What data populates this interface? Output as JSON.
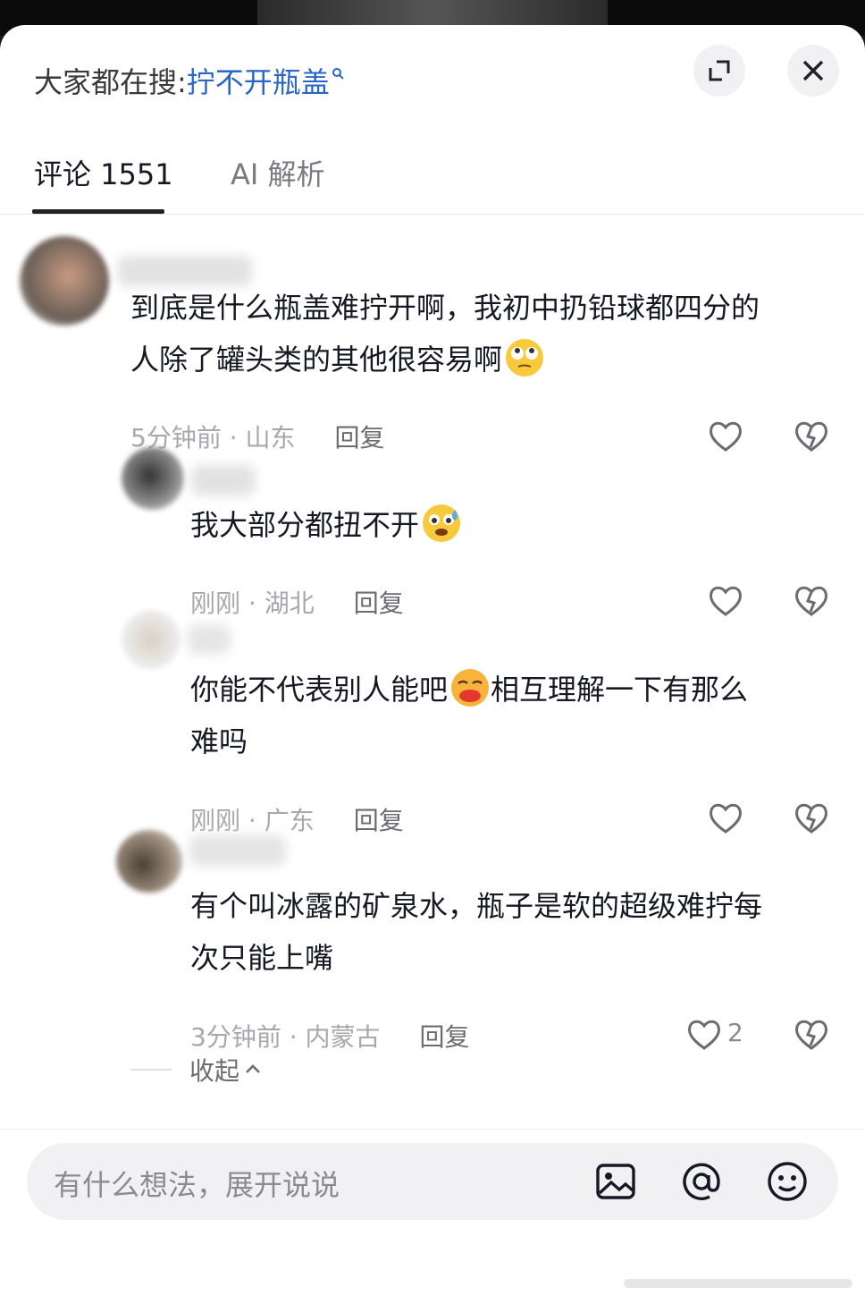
{
  "header": {
    "search_prefix": "大家都在搜:",
    "search_term": "拧不开瓶盖"
  },
  "tabs": [
    {
      "label": "评论 1551"
    },
    {
      "label": "AI 解析"
    }
  ],
  "comments": [
    {
      "text": "到底是什么瓶盖难拧开啊，我初中扔铅球都四分的\n人除了罐头类的其他很容易啊",
      "emoji": "rolling-eyes-emoji",
      "meta": "5分钟前 · 山东",
      "reply": "回复"
    },
    {
      "text": "我大部分都扭不开",
      "emoji": "sweating-face-emoji",
      "meta": "刚刚 · 湖北",
      "reply": "回复"
    },
    {
      "text": "你能不代表别人能吧",
      "text2": "相互理解一下有那么\n难吗",
      "emoji": "kissing-emoji",
      "meta": "刚刚 · 广东",
      "reply": "回复"
    },
    {
      "text": "有个叫冰露的矿泉水，瓶子是软的超级难拧每\n次只能上嘴",
      "meta": "3分钟前 · 内蒙古",
      "reply": "回复",
      "likes": "2"
    }
  ],
  "collapse_label": "收起",
  "input": {
    "placeholder": "有什么想法，展开说说"
  },
  "icons": [
    "expand-icon",
    "close-icon",
    "heart-icon",
    "dislike-heart-icon",
    "image-icon",
    "at-icon",
    "emoji-icon"
  ]
}
